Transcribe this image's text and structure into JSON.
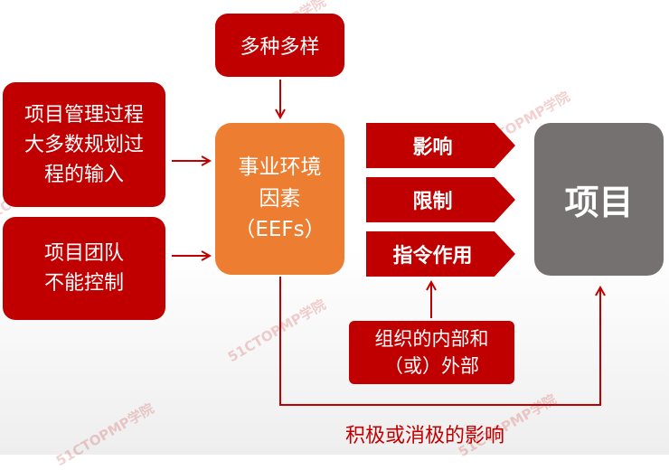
{
  "diagram": {
    "top_box": "多种多样",
    "input_box_1": "项目管理过程\n大多数规划过\n程的输入",
    "input_box_2": "项目团队\n不能控制",
    "center_box": "事业环境\n因素\n（EEFs）",
    "effects": [
      "影响",
      "限制",
      "指令作用"
    ],
    "project_box": "项目",
    "source_box": "组织的内部和\n（或）外部",
    "bottom_caption": "积极或消极的影响"
  },
  "watermark_text": "51CTOPMP学院",
  "colors": {
    "red": "#c00000",
    "orange": "#ed7d31",
    "gray": "#767171"
  }
}
